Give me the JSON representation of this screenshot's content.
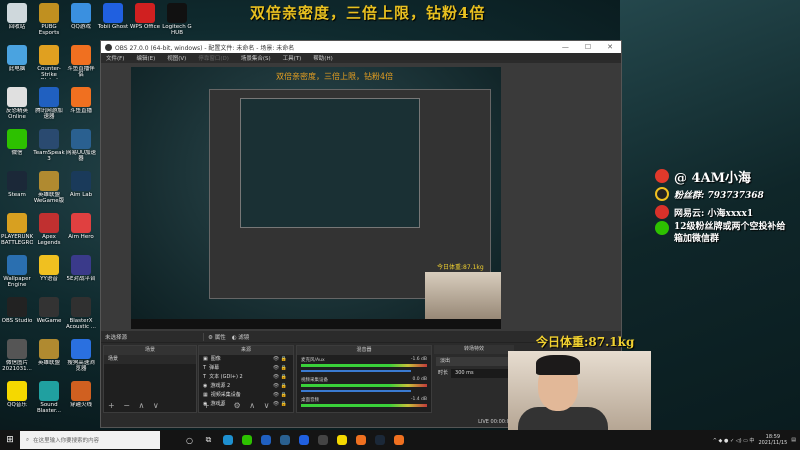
{
  "banner": "双倍亲密度，三倍上限，钻粉4倍",
  "desktop_icons": [
    {
      "label": "回收站",
      "color": "#cfd8dc"
    },
    {
      "label": "此电脑",
      "color": "#4aa3e0"
    },
    {
      "label": "反恐精英Online",
      "color": "#e0e0e0"
    },
    {
      "label": "微信",
      "color": "#2dc100"
    },
    {
      "label": "Steam",
      "color": "#1b2838"
    },
    {
      "label": "PLAYERUNKNOWN'S BATTLEGROUNDS",
      "color": "#d8a020"
    },
    {
      "label": "Wallpaper Engine",
      "color": "#2a6fb0"
    },
    {
      "label": "OBS Studio",
      "color": "#222222"
    },
    {
      "label": "微信图片2021031...",
      "color": "#555555"
    },
    {
      "label": "QQ音乐",
      "color": "#f5d800"
    },
    {
      "label": "PUBG Esports",
      "color": "#c09020"
    },
    {
      "label": "Counter-Strike Global Off...",
      "color": "#e0a020"
    },
    {
      "label": "腾讯网游加速器",
      "color": "#2060c0"
    },
    {
      "label": "TeamSpeak 3",
      "color": "#2a4a70"
    },
    {
      "label": "英雄联盟WeGame版",
      "color": "#b08a30"
    },
    {
      "label": "Apex Legends",
      "color": "#c03030"
    },
    {
      "label": "YY语音",
      "color": "#f0c020"
    },
    {
      "label": "WeGame",
      "color": "#333333"
    },
    {
      "label": "英雄联盟",
      "color": "#b08a30"
    },
    {
      "label": "Sound Blaster...",
      "color": "#20a0a0"
    },
    {
      "label": "QQ游戏",
      "color": "#3a90e0"
    },
    {
      "label": "斗鱼直播伴侣",
      "color": "#f07020"
    },
    {
      "label": "斗鱼直播",
      "color": "#f07020"
    },
    {
      "label": "网易UU加速器",
      "color": "#2a6090"
    },
    {
      "label": "Aim Lab",
      "color": "#1a3a5a"
    },
    {
      "label": "Aim Hero",
      "color": "#e04040"
    },
    {
      "label": "5E对战平台",
      "color": "#3a3a8a"
    },
    {
      "label": "BlasterX Acoustic ...",
      "color": "#303030"
    },
    {
      "label": "搜狗高速浏览器",
      "color": "#2a70e0"
    },
    {
      "label": "穿越火线",
      "color": "#d06020"
    }
  ],
  "top_icons": [
    {
      "label": "Tobii Ghost",
      "color": "#2060e0"
    },
    {
      "label": "WPS Office",
      "color": "#d02020"
    },
    {
      "label": "Logitech G HUB",
      "color": "#111111"
    }
  ],
  "obs": {
    "title": "OBS 27.0.0 (64-bit, windows) - 配置文件: 未命名 - 场景: 未命名",
    "menu": [
      "文件(F)",
      "编辑(E)",
      "视图(V)",
      "停靠窗口(D)",
      "场景集合(S)",
      "工具(T)",
      "帮助(H)"
    ],
    "no_source": "未选择源",
    "properties": "属性",
    "filters": "滤镜",
    "scenes_header": "场景",
    "scenes": [
      "场景"
    ],
    "sources_header": "来源",
    "sources": [
      "图像",
      "弹幕",
      "文本 (GDI+) 2",
      "游戏源 2",
      "视频采集设备",
      "游戏源"
    ],
    "mixer_header": "混音器",
    "mixer": [
      {
        "name": "麦克风/Aux",
        "db": "-1.6 dB"
      },
      {
        "name": "视频采集设备",
        "db": "0.0 dB"
      },
      {
        "name": "桌面音频",
        "db": "-1.4 dB"
      }
    ],
    "transitions_header": "转场特效",
    "transition": "淡出",
    "duration_label": "时长",
    "duration": "300 ms",
    "live_label": "LIVE",
    "live_time": "00:00:00"
  },
  "social": {
    "weibo": "@ 4AM小海",
    "qq": "粉丝群: 793737368",
    "netease": "网易云: 小海xxxx1",
    "wechat": "12级粉丝牌或两个空投补给箱加微信群"
  },
  "weight": "今日体重:87.1kg",
  "taskbar": {
    "search_placeholder": "在这里输入你要搜索的内容",
    "time": "18:59",
    "date": "2021/11/15"
  },
  "taskbar_apps": [
    {
      "name": "edge",
      "color": "#1e90d0"
    },
    {
      "name": "wechat",
      "color": "#2dc100"
    },
    {
      "name": "tencent-accelerator",
      "color": "#2060c0"
    },
    {
      "name": "uu-accelerator",
      "color": "#2a6090"
    },
    {
      "name": "tobii",
      "color": "#2060e0"
    },
    {
      "name": "obs",
      "color": "#444444"
    },
    {
      "name": "qq-music",
      "color": "#f5d800"
    },
    {
      "name": "douyu",
      "color": "#f07020"
    },
    {
      "name": "steam",
      "color": "#1b2838"
    },
    {
      "name": "douyu-companion",
      "color": "#f07020"
    }
  ]
}
